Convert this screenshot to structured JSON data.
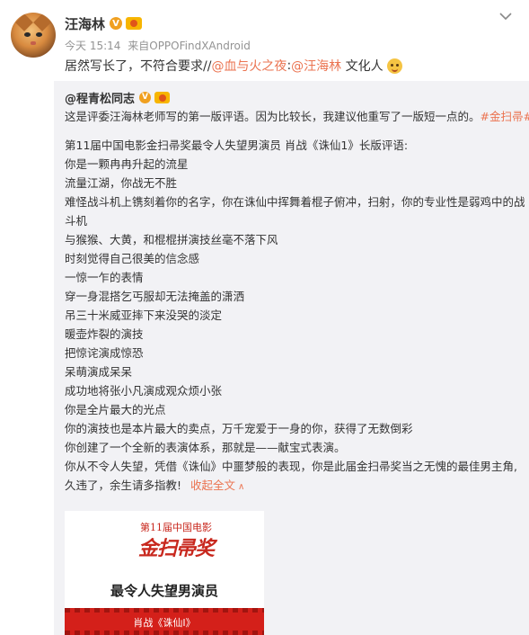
{
  "user": {
    "name": "汪海林",
    "verified_mark": "V"
  },
  "meta": {
    "time": "今天 15:14",
    "source_prefix": "来自",
    "source": "OPPOFindXAndroid"
  },
  "post": {
    "text_prefix": "居然写长了，不符合要求//",
    "mention_1": "@血与火之夜",
    "separator": ":",
    "mention_2": "@汪海林",
    "text_suffix": " 文化人"
  },
  "repost": {
    "author": "@程青松同志",
    "intro_text": "这是评委汪海林老师写的第一版评语。因为比较长，我建议他重写了一版短一点的。",
    "intro_tag": "#金扫帚#",
    "lines": [
      "第11届中国电影金扫帚奖最令人失望男演员 肖战《诛仙1》长版评语:",
      "你是一颗冉冉升起的流星",
      "流量江湖，你战无不胜",
      "难怪战斗机上镌刻着你的名字，你在诛仙中挥舞着棍子俯冲，扫射，你的专业性是弱鸡中的战",
      "斗机",
      "与猴猴、大黄，和棍棍拼演技丝毫不落下风",
      "时刻觉得自己很美的信念感",
      "一惊一乍的表情",
      "穿一身混搭乞丐服却无法掩盖的潇洒",
      "吊三十米威亚摔下来没哭的淡定",
      "暖壶炸裂的演技",
      "把惊诧演成惊恐",
      "呆萌演成呆呆",
      "成功地将张小凡演成观众烦小张",
      "你是全片最大的光点",
      "你的演技也是本片最大的卖点，万千宠爱于一身的你，获得了无数倒彩",
      "你创建了一个全新的表演体系，那就是——献宝式表演。",
      "你从不令人失望，凭借《诛仙》中噩梦般的表现，你是此届金扫帚奖当之无愧的最佳男主角,"
    ],
    "last_line": "久违了，余生请多指教!",
    "collapse_label": "收起全文",
    "poster": {
      "logo_top": "第11届中国电影",
      "logo_main": "金扫帚奖",
      "title": "最令人失望男演员",
      "band_label": "肖战《诛仙Ⅰ》"
    }
  },
  "colors": {
    "link": "#eb7350",
    "repost_bg": "#f2f2f5",
    "poster_red": "#d4201a"
  },
  "icons": [
    "chevron-down-icon",
    "verified-icon",
    "level-badge-icon",
    "emoji-face-icon"
  ]
}
